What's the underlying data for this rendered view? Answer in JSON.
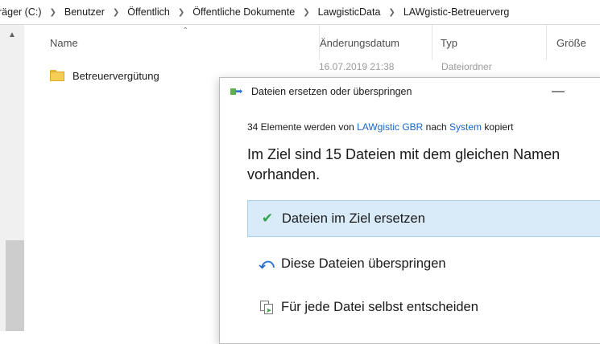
{
  "breadcrumb": [
    "räger (C:)",
    "Benutzer",
    "Öffentlich",
    "Öffentliche Dokumente",
    "LawgisticData",
    "LAWgistic-Betreuerverg"
  ],
  "columns": {
    "name": "Name",
    "date": "Änderungsdatum",
    "type": "Typ",
    "size": "Größe"
  },
  "files": [
    {
      "name": "Betreuervergütung",
      "date": "16.07.2019 21:38",
      "type": "Dateiordner"
    }
  ],
  "dialog": {
    "title": "Dateien ersetzen oder überspringen",
    "minimize_label": "—",
    "subline": {
      "prefix": "34 Elemente werden von ",
      "source": "LAWgistic GBR",
      "mid": " nach ",
      "target": "System",
      "suffix": " kopiert"
    },
    "headline": "Im Ziel sind 15 Dateien mit dem gleichen Namen vorhanden.",
    "options": {
      "replace": "Dateien im Ziel ersetzen",
      "skip": "Diese Dateien überspringen",
      "decide": "Für jede Datei selbst entscheiden"
    }
  },
  "icons": {
    "replace": "checkmark-icon",
    "skip": "skip-arrow-icon",
    "decide": "compare-files-icon"
  },
  "colors": {
    "link": "#1a65c6",
    "selected_option_bg": "#d9ebf9",
    "check": "#2fa34a"
  }
}
